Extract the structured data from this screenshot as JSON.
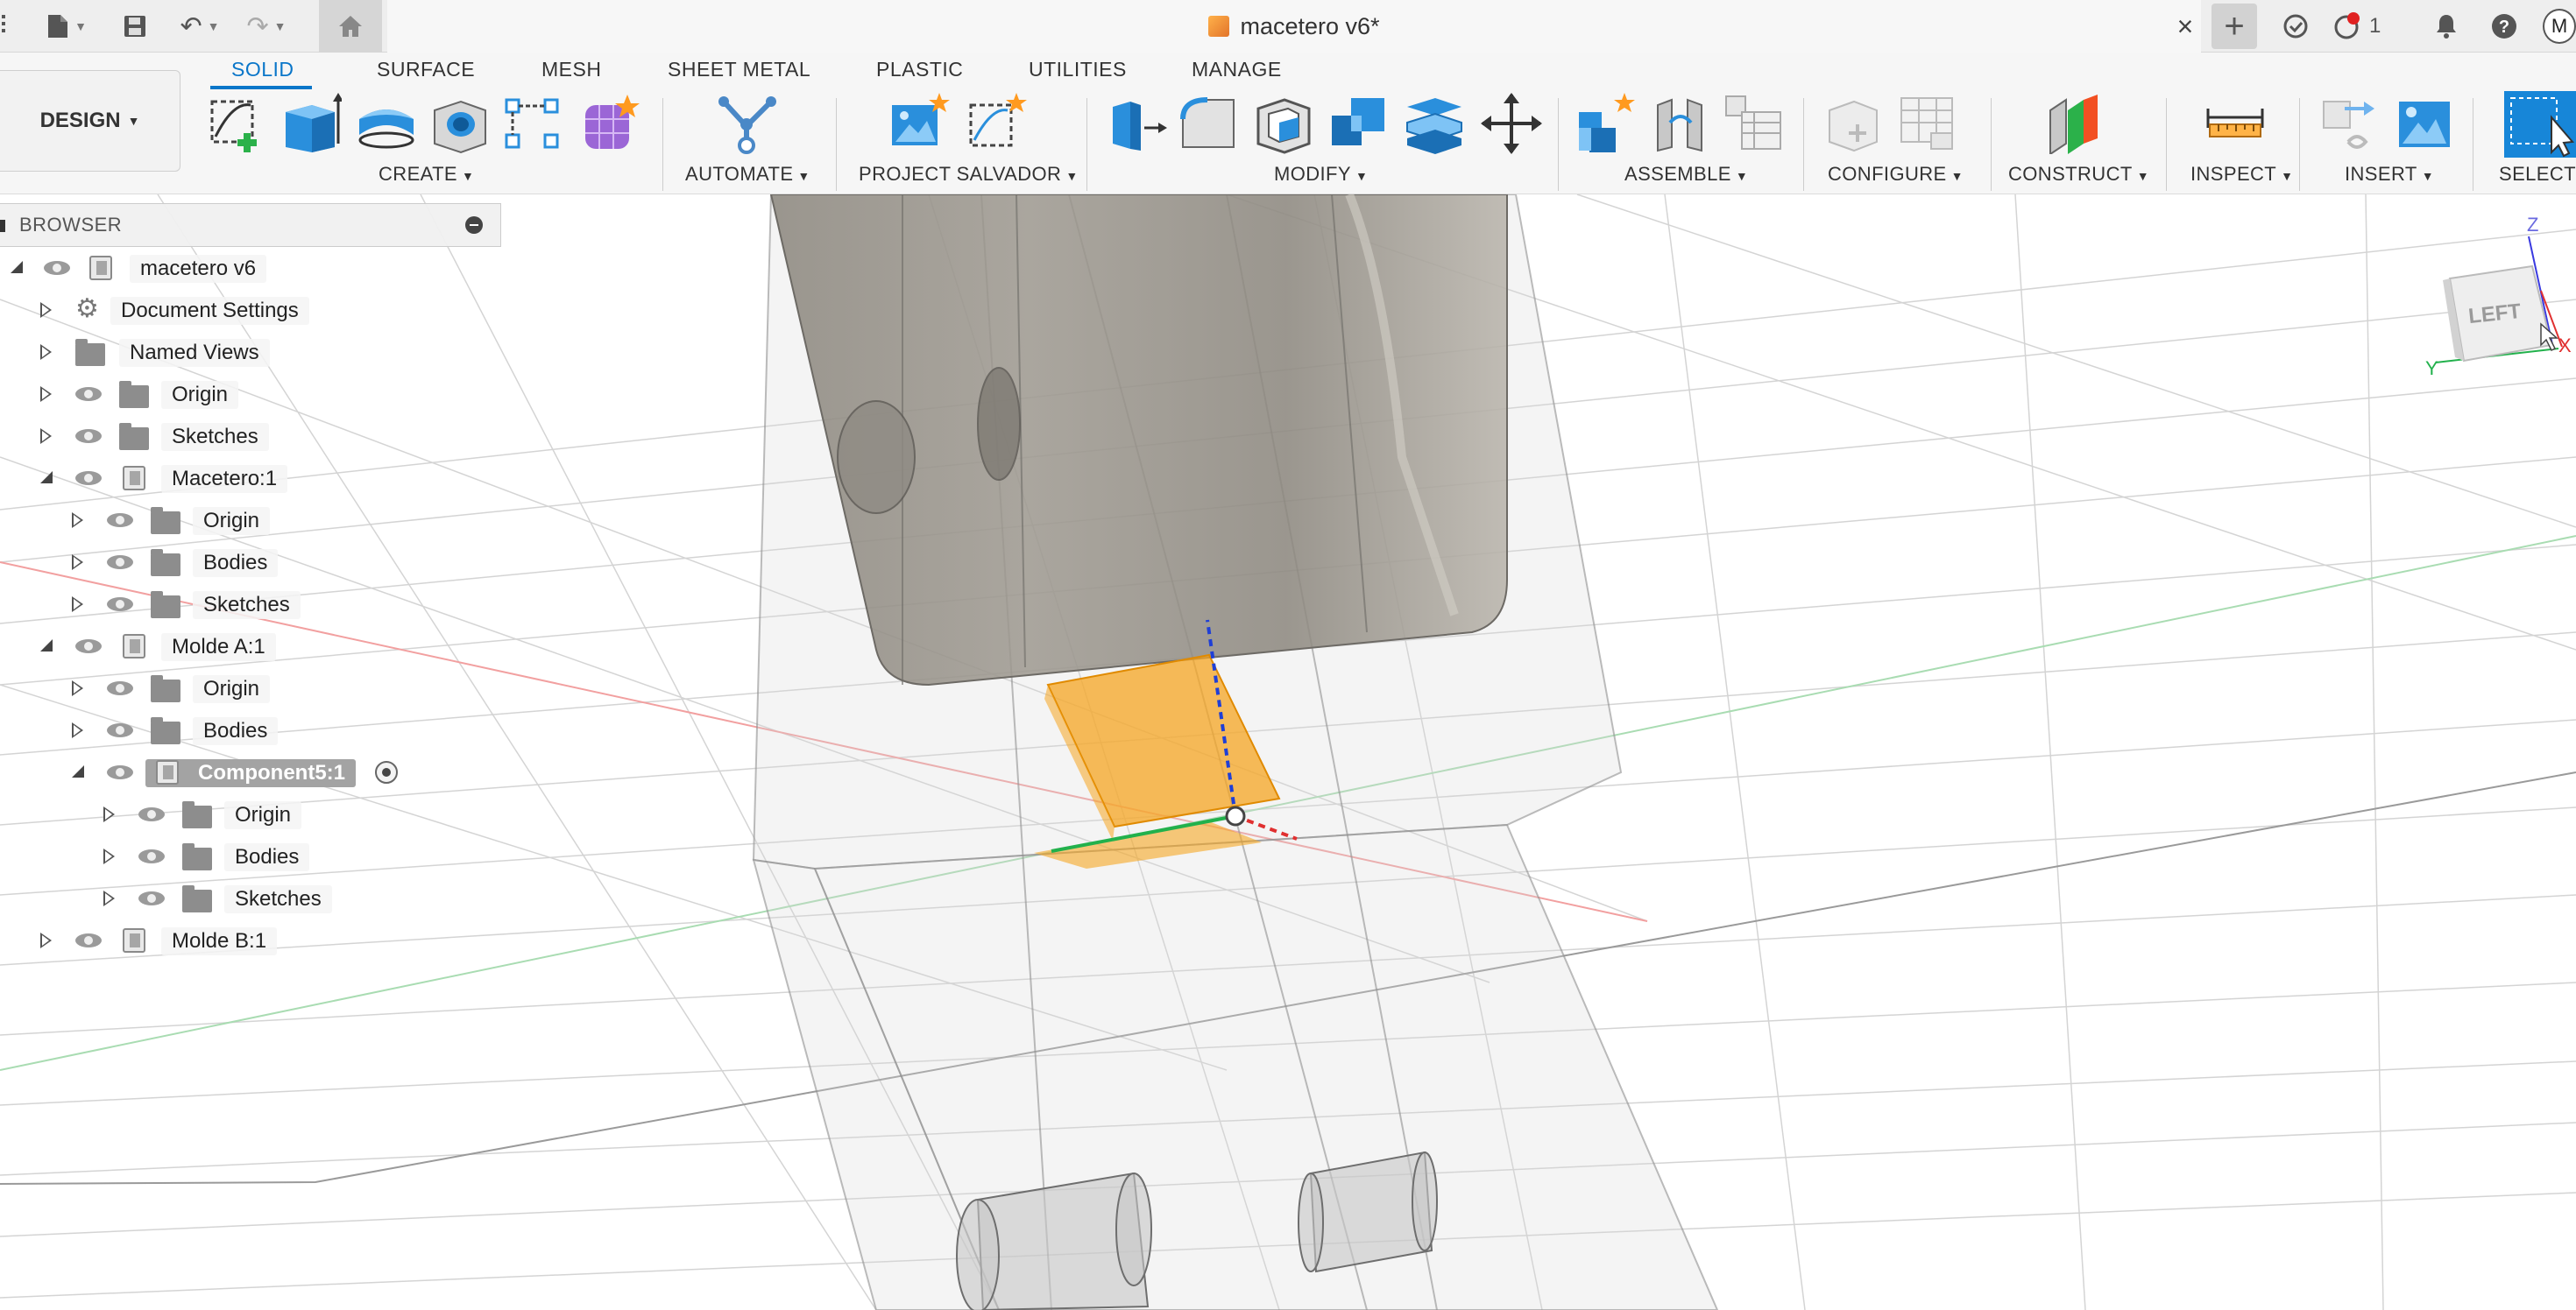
{
  "document": {
    "title": "macetero v6*"
  },
  "titlebar": {
    "notification_count": "1",
    "account_initial": "M"
  },
  "workspace": {
    "label": "DESIGN"
  },
  "tabs": [
    {
      "label": "SOLID",
      "active": true
    },
    {
      "label": "SURFACE",
      "active": false
    },
    {
      "label": "MESH",
      "active": false
    },
    {
      "label": "SHEET METAL",
      "active": false
    },
    {
      "label": "PLASTIC",
      "active": false
    },
    {
      "label": "UTILITIES",
      "active": false
    },
    {
      "label": "MANAGE",
      "active": false
    }
  ],
  "toolbar_groups": [
    {
      "label": "CREATE"
    },
    {
      "label": "AUTOMATE"
    },
    {
      "label": "PROJECT SALVADOR"
    },
    {
      "label": "MODIFY"
    },
    {
      "label": "ASSEMBLE"
    },
    {
      "label": "CONFIGURE"
    },
    {
      "label": "CONSTRUCT"
    },
    {
      "label": "INSPECT"
    },
    {
      "label": "INSERT"
    },
    {
      "label": "SELECT"
    }
  ],
  "browser": {
    "header": "BROWSER",
    "items": [
      {
        "label": "macetero v6",
        "expanded": true
      },
      {
        "label": "Document Settings",
        "expanded": false
      },
      {
        "label": "Named Views",
        "expanded": false
      },
      {
        "label": "Origin",
        "expanded": false
      },
      {
        "label": "Sketches",
        "expanded": false
      },
      {
        "label": "Macetero:1",
        "expanded": true
      },
      {
        "label": "Origin",
        "expanded": false
      },
      {
        "label": "Bodies",
        "expanded": false
      },
      {
        "label": "Sketches",
        "expanded": false
      },
      {
        "label": "Molde A:1",
        "expanded": true
      },
      {
        "label": "Origin",
        "expanded": false
      },
      {
        "label": "Bodies",
        "expanded": false
      },
      {
        "label": "Component5:1",
        "expanded": true,
        "active": true
      },
      {
        "label": "Origin",
        "expanded": false
      },
      {
        "label": "Bodies",
        "expanded": false
      },
      {
        "label": "Sketches",
        "expanded": false
      },
      {
        "label": "Molde B:1",
        "expanded": false
      }
    ]
  },
  "viewcube": {
    "face": "LEFT",
    "axis_z": "Z",
    "axis_y": "Y",
    "axis_x": "X"
  },
  "colors": {
    "accent": "#0a76c9",
    "selection_orange": "#f5a623",
    "axis_x": "#e03030",
    "axis_y": "#22b14c",
    "axis_z": "#1f3fd6"
  }
}
